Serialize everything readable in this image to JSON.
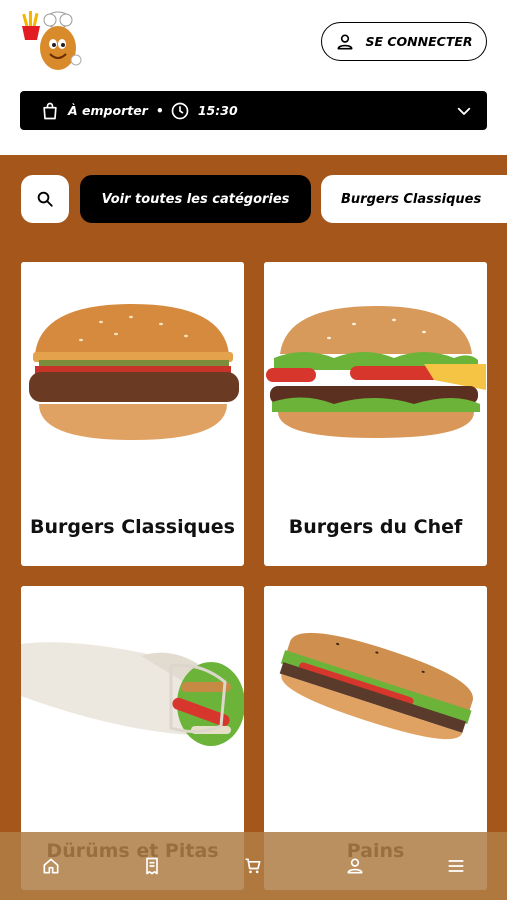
{
  "header": {
    "logo_icon": "chef-potato-mascot-logo",
    "login_label": "SE CONNECTER",
    "login_icon": "user-icon"
  },
  "order_bar": {
    "mode_label": "À emporter",
    "separator": "•",
    "time": "15:30",
    "mode_icon": "shopping-bag-icon",
    "time_icon": "clock-icon",
    "toggle_icon": "chevron-down-icon"
  },
  "categories_bar": {
    "search_icon": "search-icon",
    "all_label": "Voir toutes les catégories",
    "chip_label": "Burgers Classiques"
  },
  "products": [
    {
      "label": "Burgers Classiques",
      "image": "classic-burger"
    },
    {
      "label": "Burgers du Chef",
      "image": "chef-burger"
    },
    {
      "label": "Dürüms et Pitas",
      "image": "durum-wrap"
    },
    {
      "label": "Pains",
      "image": "sandwich-bread"
    }
  ],
  "bottom_nav": {
    "items": [
      "home-icon",
      "receipt-icon",
      "cart-icon",
      "user-icon",
      "menu-icon"
    ]
  },
  "colors": {
    "accent": "#a5561b",
    "dark": "#000000",
    "card": "#ffffff"
  }
}
